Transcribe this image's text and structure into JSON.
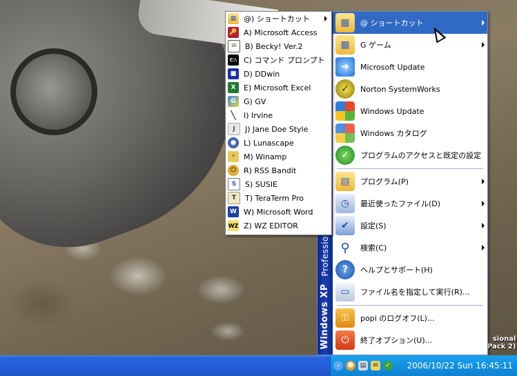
{
  "desktop": {
    "corner_label_line1": "sional",
    "corner_label_line2": "Pack 2)"
  },
  "start_menu": {
    "brand": "Windows XP",
    "brand_edition": "Professio",
    "items": [
      {
        "label": "@ ショートカット",
        "icon": "folder-apps-icon",
        "submenu": true,
        "highlighted": true
      },
      {
        "label": "G ゲーム",
        "icon": "folder-apps-icon",
        "submenu": true
      },
      {
        "label": "Microsoft Update",
        "icon": "update-icon",
        "submenu": false
      },
      {
        "label": "Norton SystemWorks",
        "icon": "norton-icon",
        "submenu": false
      },
      {
        "label": "Windows Update",
        "icon": "windows-icon",
        "submenu": false
      },
      {
        "label": "Windows カタログ",
        "icon": "catalog-icon",
        "submenu": false
      },
      {
        "label": "プログラムのアクセスと既定の設定",
        "icon": "defaults-icon",
        "submenu": false
      },
      {
        "label": "プログラム(P)",
        "icon": "programs-icon",
        "submenu": true
      },
      {
        "label": "最近使ったファイル(D)",
        "icon": "recent-icon",
        "submenu": true
      },
      {
        "label": "設定(S)",
        "icon": "settings-icon",
        "submenu": true
      },
      {
        "label": "検索(C)",
        "icon": "search-icon",
        "submenu": true
      },
      {
        "label": "ヘルプとサポート(H)",
        "icon": "help-icon",
        "submenu": false
      },
      {
        "label": "ファイル名を指定して実行(R)...",
        "icon": "run-icon",
        "submenu": false
      },
      {
        "label": "popi のログオフ(L)...",
        "icon": "logoff-icon",
        "submenu": false
      },
      {
        "label": "終了オプション(U)...",
        "icon": "shutdown-icon",
        "submenu": false
      }
    ]
  },
  "submenu": {
    "items": [
      {
        "label": "@) ショートカット",
        "icon": "folder-apps-icon",
        "submenu": true
      },
      {
        "label": "A) Microsoft Access",
        "icon": "access-icon"
      },
      {
        "label": "B) Becky! Ver.2",
        "icon": "becky-icon"
      },
      {
        "label": "C) コマンド プロンプト",
        "icon": "cmd-icon"
      },
      {
        "label": "D) DDwin",
        "icon": "ddwin-icon"
      },
      {
        "label": "E) Microsoft Excel",
        "icon": "excel-icon"
      },
      {
        "label": "G) GV",
        "icon": "gv-icon"
      },
      {
        "label": "I) Irvine",
        "icon": "irvine-icon"
      },
      {
        "label": "J) Jane Doe Style",
        "icon": "jane-icon"
      },
      {
        "label": "L) Lunascape",
        "icon": "lunascape-icon"
      },
      {
        "label": "M) Winamp",
        "icon": "winamp-icon"
      },
      {
        "label": "R) RSS Bandit",
        "icon": "rss-icon"
      },
      {
        "label": "S) SUSIE",
        "icon": "susie-icon"
      },
      {
        "label": "T) TeraTerm Pro",
        "icon": "teraterm-icon"
      },
      {
        "label": "W) Microsoft Word",
        "icon": "word-icon"
      },
      {
        "label": "Z) WZ EDITOR",
        "icon": "wz-icon"
      }
    ]
  },
  "taskbar": {
    "clock": "2006/10/22 Sun 16:45:11"
  }
}
